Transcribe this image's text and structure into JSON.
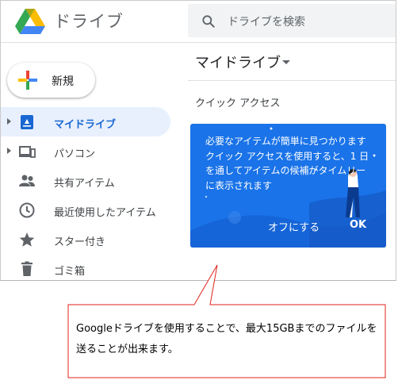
{
  "app": {
    "title": "ドライブ"
  },
  "search": {
    "placeholder": "ドライブを検索"
  },
  "new_button": {
    "label": "新規"
  },
  "nav": {
    "items": [
      {
        "label": "マイドライブ",
        "icon": "drive-icon",
        "active": true,
        "expandable": true
      },
      {
        "label": "パソコン",
        "icon": "computers-icon",
        "active": false,
        "expandable": true
      },
      {
        "label": "共有アイテム",
        "icon": "people-icon",
        "active": false,
        "expandable": false
      },
      {
        "label": "最近使用したアイテム",
        "icon": "clock-icon",
        "active": false,
        "expandable": false
      },
      {
        "label": "スター付き",
        "icon": "star-icon",
        "active": false,
        "expandable": false
      },
      {
        "label": "ゴミ箱",
        "icon": "trash-icon",
        "active": false,
        "expandable": false
      }
    ]
  },
  "main": {
    "title": "マイドライブ",
    "quick_access_label": "クイック アクセス",
    "card": {
      "text": "必要なアイテムが簡単に見つかります クイック アクセスを使用すると、1 日を通してアイテムの候補がタイムリーに表示されます",
      "off_label": "オフにする",
      "ok_label": "OK"
    }
  },
  "callout": {
    "text": "Googleドライブを使用することで、最大15GBまでのファイルを送ることが出来ます。"
  },
  "colors": {
    "active_bg": "#e8f0fe",
    "active_text": "#1967d2",
    "card_blue": "#1a73e8",
    "callout_border": "#e0231c"
  }
}
